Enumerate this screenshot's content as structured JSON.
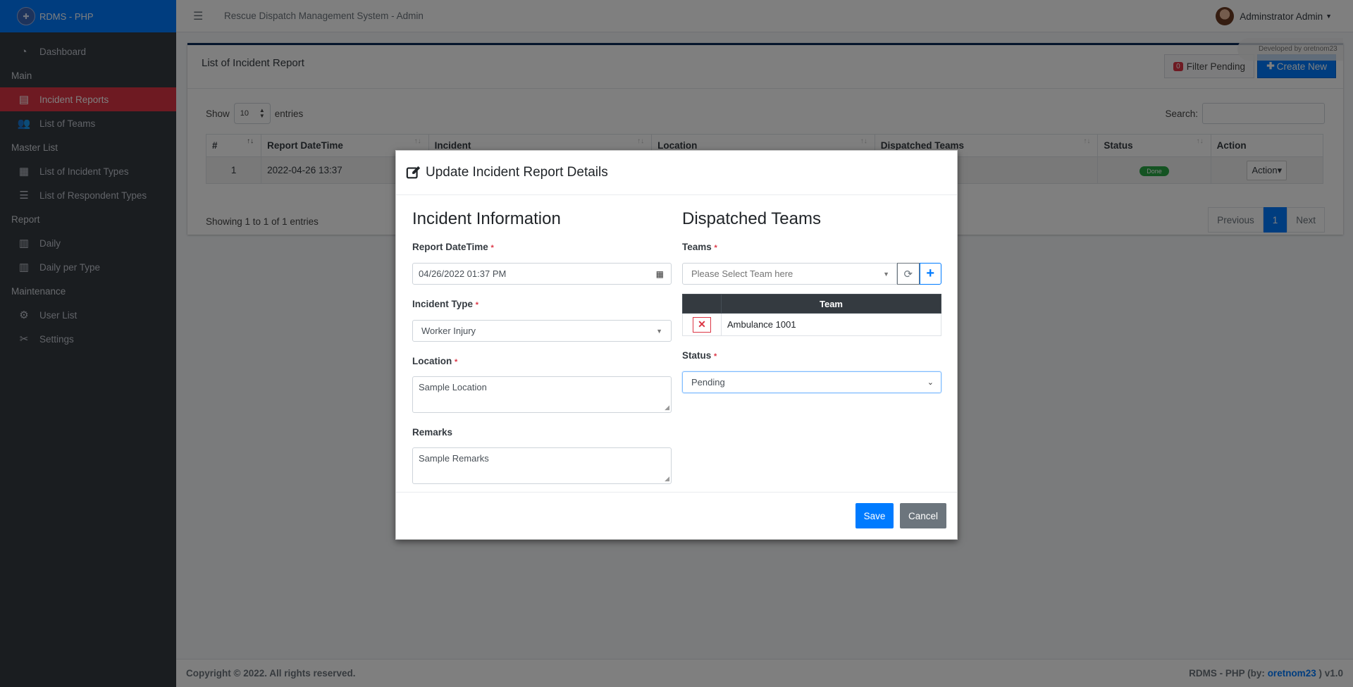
{
  "brand": {
    "name": "RDMS - PHP"
  },
  "sidebar": {
    "items": [
      {
        "type": "item",
        "label": "Dashboard",
        "icon": "dashboard-icon"
      },
      {
        "type": "header",
        "label": "Main"
      },
      {
        "type": "item",
        "label": "Incident Reports",
        "icon": "file-icon",
        "active": true
      },
      {
        "type": "item",
        "label": "List of Teams",
        "icon": "users-icon"
      },
      {
        "type": "header",
        "label": "Master List"
      },
      {
        "type": "item",
        "label": "List of Incident Types",
        "icon": "table-icon"
      },
      {
        "type": "item",
        "label": "List of Respondent Types",
        "icon": "list-icon"
      },
      {
        "type": "header",
        "label": "Report"
      },
      {
        "type": "item",
        "label": "Daily",
        "icon": "calendar-icon"
      },
      {
        "type": "item",
        "label": "Daily per Type",
        "icon": "calendar-icon"
      },
      {
        "type": "header",
        "label": "Maintenance"
      },
      {
        "type": "item",
        "label": "User List",
        "icon": "users-cog-icon"
      },
      {
        "type": "item",
        "label": "Settings",
        "icon": "tools-icon"
      }
    ]
  },
  "header": {
    "system_title": "Rescue Dispatch Management System - Admin",
    "user_name": "Adminstrator Admin"
  },
  "card": {
    "title": "List of Incident Report",
    "filter_badge": "0",
    "filter_label": "Filter Pending",
    "create_label": "Create New",
    "dev_tag": "Developed by oretnom23",
    "show_label": "Show",
    "entries_value": "10",
    "entries_label": "entries",
    "search_label": "Search:",
    "columns": [
      "#",
      "Report DateTime",
      "Incident",
      "Location",
      "Dispatched Teams",
      "Status",
      "Action"
    ],
    "rows": [
      {
        "num": "1",
        "datetime": "2022-04-26 13:37",
        "incident": "",
        "location": "",
        "teams": "",
        "status": "Done",
        "action": "Action"
      }
    ],
    "showing": "Showing 1 to 1 of 1 entries",
    "pager": {
      "prev": "Previous",
      "page": "1",
      "next": "Next"
    }
  },
  "footer": {
    "copyright": "Copyright © 2022. All rights reserved.",
    "right_prefix": "RDMS - PHP (by: ",
    "author": "oretnom23",
    "right_suffix": " ) v1.0"
  },
  "modal": {
    "title": "Update Incident Report Details",
    "left": {
      "section": "Incident Information",
      "datetime_label": "Report DateTime",
      "datetime_value": "04/26/2022 01:37 PM",
      "type_label": "Incident Type",
      "type_value": "Worker Injury",
      "location_label": "Location",
      "location_value": "Sample Location",
      "remarks_label": "Remarks",
      "remarks_value": "Sample Remarks"
    },
    "right": {
      "section": "Dispatched Teams",
      "teams_label": "Teams",
      "teams_placeholder": "Please Select Team here",
      "team_col": "Team",
      "teams": [
        "Ambulance 1001"
      ],
      "status_label": "Status",
      "status_value": "Pending"
    },
    "save_label": "Save",
    "cancel_label": "Cancel",
    "required_mark": "*"
  }
}
